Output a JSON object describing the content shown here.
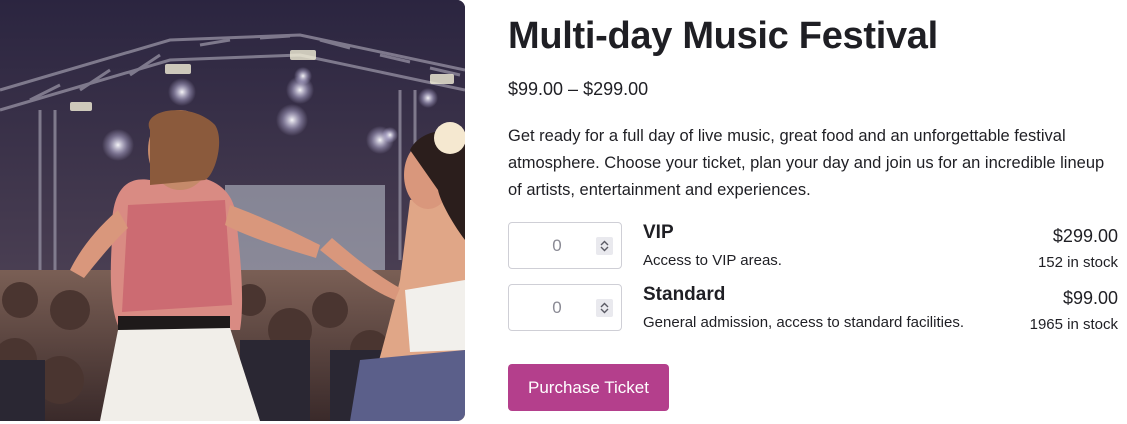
{
  "hero": {
    "image_alt": "Festival-goers dancing in front of a concert stage"
  },
  "product": {
    "title": "Multi-day Music Festival",
    "price_range": "$99.00 – $299.00",
    "description": "Get ready for a full day of live music, great food and an unforgettable festival atmosphere. Choose your ticket, plan your day and join us for an incredible lineup of artists, entertainment and experiences."
  },
  "tickets": [
    {
      "name": "VIP",
      "description": "Access to VIP areas.",
      "price": "$299.00",
      "stock": "152 in stock",
      "quantity": "0"
    },
    {
      "name": "Standard",
      "description": "General admission, access to standard facilities.",
      "price": "$99.00",
      "stock": "1965 in stock",
      "quantity": "0"
    }
  ],
  "actions": {
    "purchase_label": "Purchase Ticket"
  },
  "colors": {
    "accent": "#b43f8c",
    "text": "#1f1f24",
    "border": "#cfcfd6"
  },
  "icons": {
    "spinner": "chevron-up-down-icon"
  }
}
